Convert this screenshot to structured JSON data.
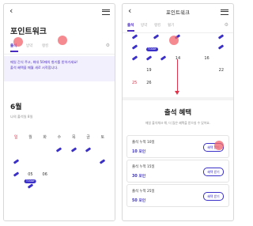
{
  "left_screen": {
    "title": "포인트워크",
    "tabs": [
      "출석",
      "방약",
      "랭킹"
    ],
    "notice": "매일 간식 주고, 최대 50매의 향기를 받아가세요!\n출석 혜택을 매월 새로 시작합니다.",
    "month": "6월",
    "month_sub": "나의 출석일 8일",
    "weekdays": [
      "일",
      "월",
      "화",
      "수",
      "목",
      "금",
      "토"
    ],
    "calendar": [
      [
        "",
        "",
        "",
        "",
        "",
        "",
        ""
      ],
      [
        "",
        "",
        "",
        "",
        "",
        "",
        ""
      ],
      [
        "",
        "05",
        "06",
        "",
        "",
        "",
        ""
      ],
      [
        "",
        "",
        "",
        "",
        "",
        "",
        ""
      ],
      [
        "",
        "",
        "",
        "",
        "",
        "",
        ""
      ]
    ],
    "badge": "TODAY"
  },
  "right_screen": {
    "title": "포인트워크",
    "tabs": [
      "출석",
      "방약",
      "랭킹",
      "혈기"
    ],
    "cal_rows": [
      [
        "",
        "",
        "",
        "",
        "",
        "",
        ""
      ],
      [
        "",
        "",
        "",
        "",
        "",
        "",
        ""
      ],
      [
        "",
        "",
        "",
        "14",
        "",
        "16",
        ""
      ],
      [
        "",
        "19",
        "",
        "",
        "",
        "",
        "22"
      ],
      [
        "25",
        "26",
        "",
        "",
        "",
        "",
        ""
      ]
    ],
    "badge": "TODAY",
    "benefit_title": "출석 혜택",
    "benefit_sub": "매일 출석체크 해, 더 많은 혜택을 받으실 수 있어요.",
    "cards": [
      {
        "label": "출석 누적 10일",
        "points": "10 포인",
        "button": "혜택 받기"
      },
      {
        "label": "출석 누적 15일",
        "points": "30 포인",
        "button": "혜택 받기"
      },
      {
        "label": "출석 누적 25일",
        "points": "50 포인",
        "button": "혜택 받기"
      }
    ]
  },
  "colors": {
    "accent": "#4a2bc2",
    "check": "#3a2fc7",
    "sunday": "#e0344b",
    "highlight": "#f2646c",
    "notice_bg": "#f2f0fc"
  },
  "icons": {
    "back": "chevron-left-icon",
    "menu": "hamburger-menu-icon",
    "settings": "gear-icon",
    "attendance_mark": "check-stamp-icon"
  }
}
